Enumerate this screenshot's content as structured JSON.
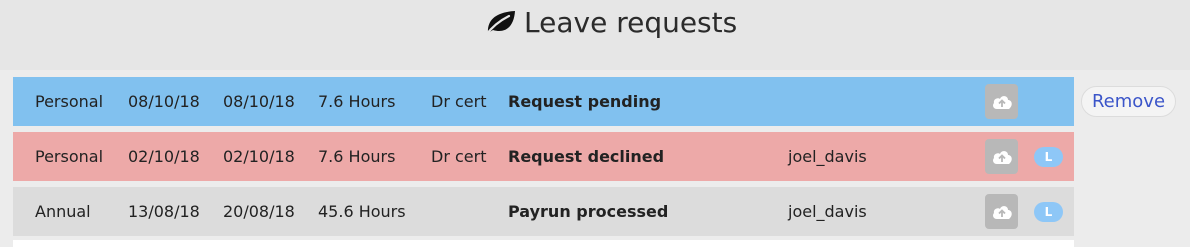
{
  "header": {
    "title": "Leave requests",
    "icon": "leaf-icon"
  },
  "requests": [
    {
      "type": "Personal",
      "start": "08/10/18",
      "end": "08/10/18",
      "hours": "7.6 Hours",
      "cert": "Dr cert",
      "status": "Request pending",
      "user": "",
      "badge": "",
      "color": "#81c1ef",
      "action_label": "Remove"
    },
    {
      "type": "Personal",
      "start": "02/10/18",
      "end": "02/10/18",
      "hours": "7.6 Hours",
      "cert": "Dr cert",
      "status": "Request declined",
      "user": "joel_davis",
      "badge": "L",
      "color": "#eda9a8"
    },
    {
      "type": "Annual",
      "start": "13/08/18",
      "end": "20/08/18",
      "hours": "45.6 Hours",
      "cert": "",
      "status": "Payrun processed",
      "user": "joel_davis",
      "badge": "L",
      "color": "#dcdcdc"
    }
  ],
  "icons": {
    "upload": "cloud-upload-icon",
    "badge_color": "#8ec7f7",
    "upload_color": "#b8b8b8"
  }
}
